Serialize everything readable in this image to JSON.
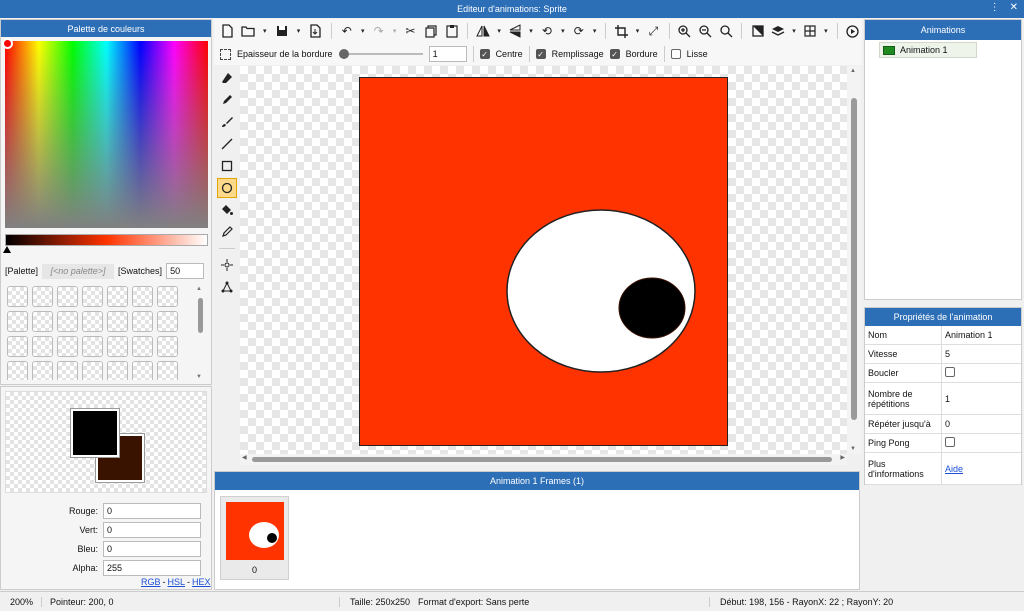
{
  "window": {
    "title": "Editeur d'animations: Sprite"
  },
  "palette_panel": {
    "title": "Palette de couleurs",
    "palette_btn": "[Palette]",
    "no_palette": "[<no palette>]",
    "swatches_btn": "[Swatches]",
    "swatches_count": "50",
    "primary_color": "#000000",
    "secondary_color": "#3a1300",
    "rouge_label": "Rouge:",
    "rouge": "0",
    "vert_label": "Vert:",
    "vert": "0",
    "bleu_label": "Bleu:",
    "bleu": "0",
    "alpha_label": "Alpha:",
    "alpha": "255",
    "link_rgb": "RGB",
    "link_hsl": "HSL",
    "link_hex": "HEX",
    "sep": "-"
  },
  "options_bar": {
    "border_label": "Epaisseur de la bordure",
    "border_value": "1",
    "centre": "Centre",
    "centre_checked": true,
    "remplissage": "Remplissage",
    "remplissage_checked": true,
    "bordure": "Bordure",
    "bordure_checked": true,
    "lisse": "Lisse",
    "lisse_checked": false
  },
  "canvas": {
    "fill_color": "#ff3300"
  },
  "frames_panel": {
    "title": "Animation 1 Frames (1)",
    "frame_index": "0"
  },
  "animations_panel": {
    "title": "Animations",
    "item": "Animation 1"
  },
  "props_panel": {
    "title": "Propriétés de l'animation",
    "rows": [
      {
        "k": "Nom",
        "v": "Animation 1"
      },
      {
        "k": "Vitesse",
        "v": "5"
      },
      {
        "k": "Boucler",
        "v": ""
      },
      {
        "k": "Nombre de répétitions",
        "v": "1"
      },
      {
        "k": "Répéter jusqu'à",
        "v": "0"
      },
      {
        "k": "Ping Pong",
        "v": ""
      },
      {
        "k": "Plus d'informations",
        "v": "Aide"
      }
    ]
  },
  "status": {
    "zoom": "200%",
    "pointer": "Pointeur: 200, 0",
    "size": "Taille: 250x250",
    "export": "Format d'export: Sans perte",
    "info": "Début: 198, 156 - RayonX: 22 ; RayonY: 20"
  }
}
